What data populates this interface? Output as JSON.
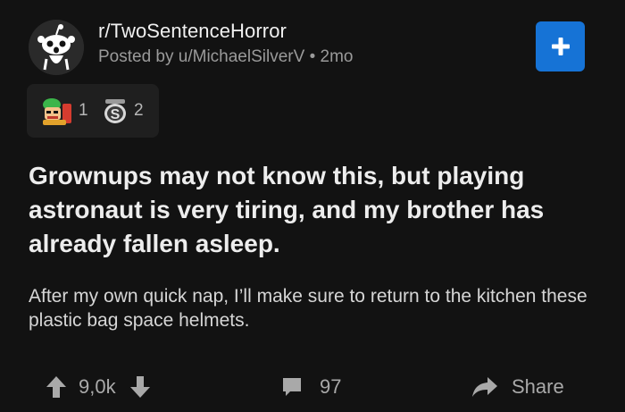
{
  "header": {
    "subreddit": "r/TwoSentenceHorror",
    "posted_by": "Posted by u/MichaelSilverV",
    "separator": "•",
    "age": "2mo",
    "join_icon": "plus-icon",
    "colors": {
      "join_button": "#1673d6",
      "background": "#121212"
    }
  },
  "awards": {
    "items": [
      {
        "icon": "chef-award-icon",
        "count": "1"
      },
      {
        "icon": "silver-coin-icon",
        "count": "2"
      }
    ]
  },
  "post": {
    "title": "Grownups may not know this, but playing astronaut is very tiring, and my brother has already fallen asleep.",
    "body": "After my own quick nap, I’ll make sure to return to the kitchen these plastic bag space helmets."
  },
  "actions": {
    "upvote_icon": "upvote-arrow-icon",
    "score": "9,0k",
    "downvote_icon": "downvote-arrow-icon",
    "comment_icon": "comment-bubble-icon",
    "comments": "97",
    "share_icon": "share-arrow-icon",
    "share_label": "Share"
  }
}
